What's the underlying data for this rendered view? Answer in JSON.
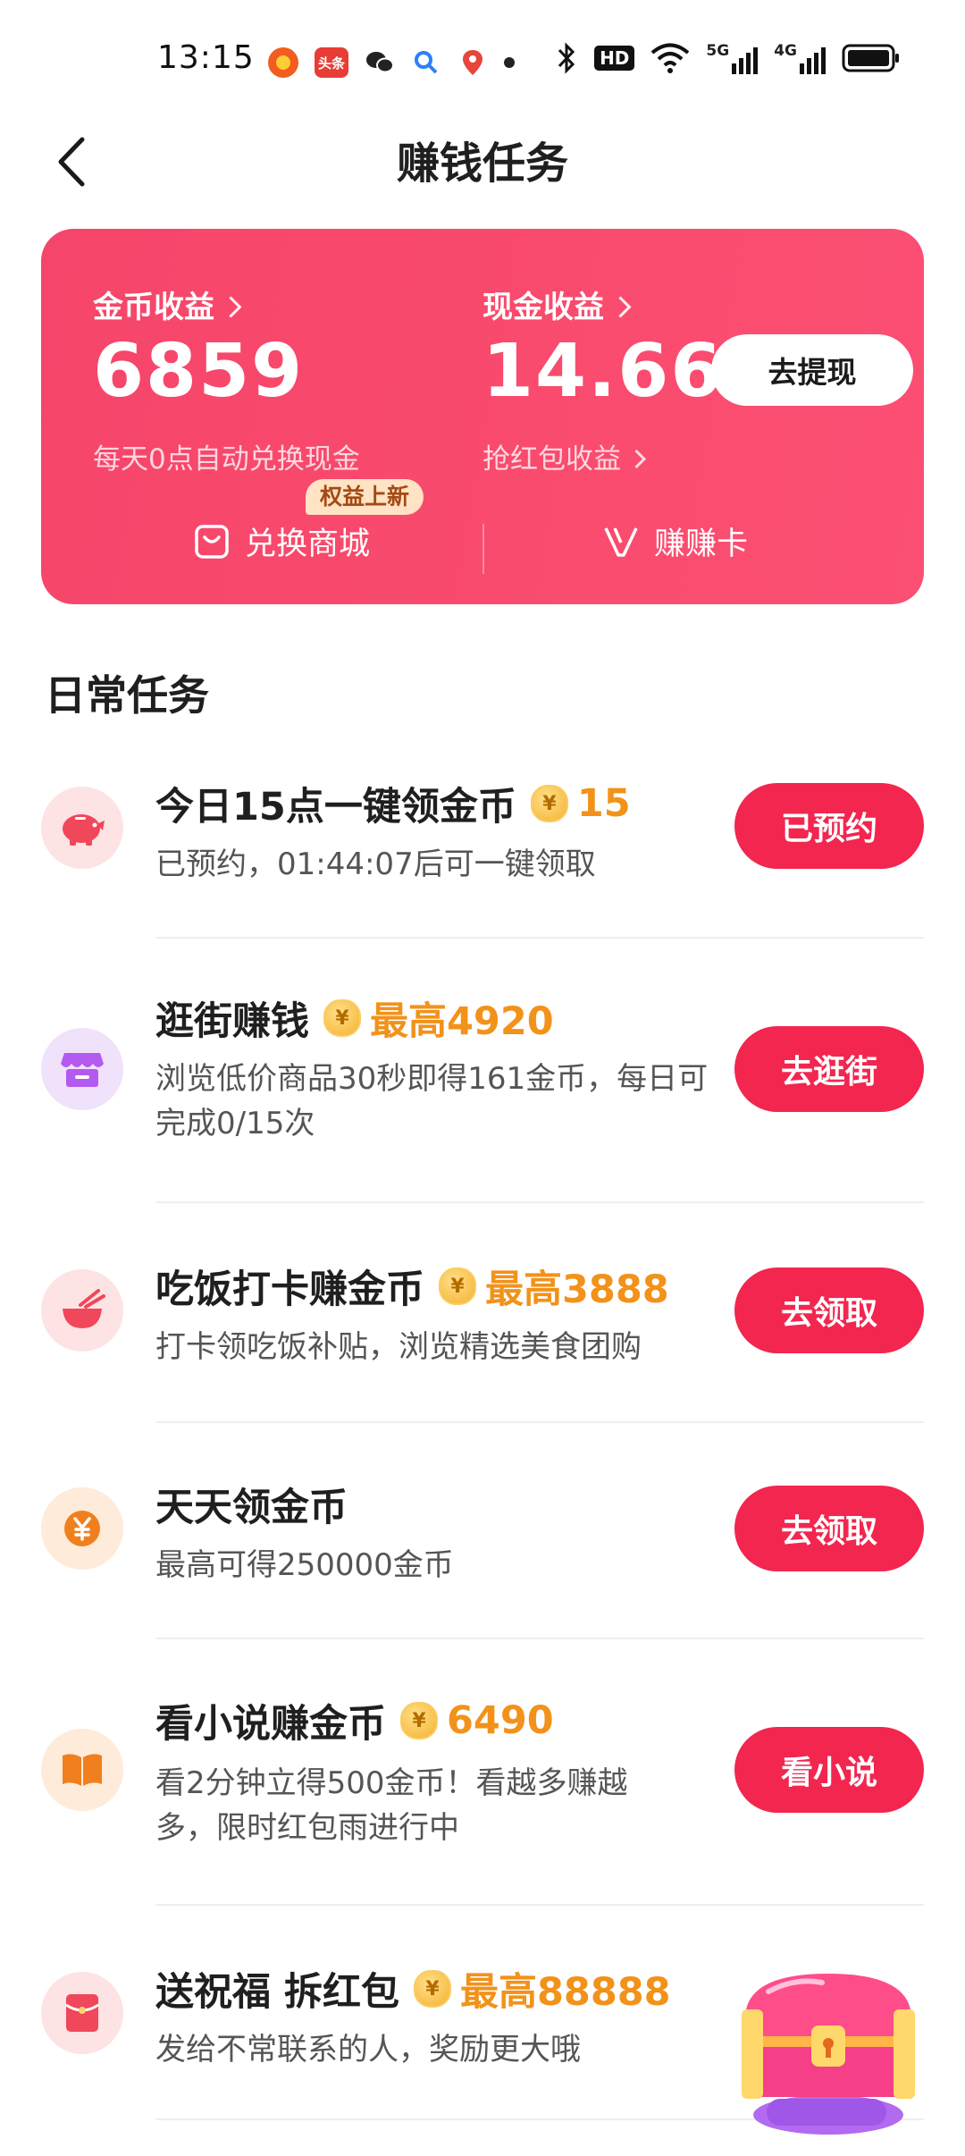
{
  "status_bar": {
    "time": "13:15",
    "apps": [
      "app-orange-icon",
      "toutiao-icon",
      "wechat-icon",
      "search-app-icon",
      "map-app-icon"
    ],
    "toutiao_label": "头条",
    "right_icons": [
      "bluetooth-icon",
      "hd-icon",
      "wifi-icon",
      "5g-signal-icon",
      "4g-signal-icon",
      "battery-icon"
    ],
    "hd_label": "HD",
    "5g_label": "5G",
    "4g_label": "4G"
  },
  "header": {
    "title": "赚钱任务"
  },
  "earnings": {
    "coin_label": "金币收益",
    "coin_value": "6859",
    "coin_note": "每天0点自动兑换现金",
    "cash_label": "现金收益",
    "cash_value": "14.66",
    "cash_note": "抢红包收益",
    "withdraw_button": "去提现",
    "shop_badge": "权益上新",
    "shop_label": "兑换商城",
    "card_label": "赚赚卡"
  },
  "daily": {
    "section_title": "日常任务",
    "tasks": [
      {
        "title": "今日15点一键领金币",
        "reward": "15",
        "desc": "已预约，01:44:07后可一键领取",
        "button": "已预约",
        "icon": "piggy-bank-icon"
      },
      {
        "title": "逛街赚钱",
        "reward": "最高4920",
        "desc": "浏览低价商品30秒即得161金币，每日可完成0/15次",
        "button": "去逛街",
        "icon": "shop-icon"
      },
      {
        "title": "吃饭打卡赚金币",
        "reward": "最高3888",
        "desc": "打卡领吃饭补贴，浏览精选美食团购",
        "button": "去领取",
        "icon": "rice-bowl-icon"
      },
      {
        "title": "天天领金币",
        "reward": "",
        "desc": "最高可得250000金币",
        "button": "去领取",
        "icon": "yen-coin-icon"
      },
      {
        "title": "看小说赚金币",
        "reward": "6490",
        "desc": "看2分钟立得500金币！看越多赚越多，限时红包雨进行中",
        "button": "看小说",
        "icon": "book-icon"
      },
      {
        "title": "送祝福 拆红包",
        "reward": "最高88888",
        "desc": "发给不常联系的人，奖励更大哦",
        "button": "",
        "icon": "red-packet-icon"
      }
    ]
  },
  "colors": {
    "accent": "#f2264f",
    "card_gradient_start": "#f6456a",
    "card_gradient_end": "#fb4f73",
    "reward": "#f2921a"
  }
}
